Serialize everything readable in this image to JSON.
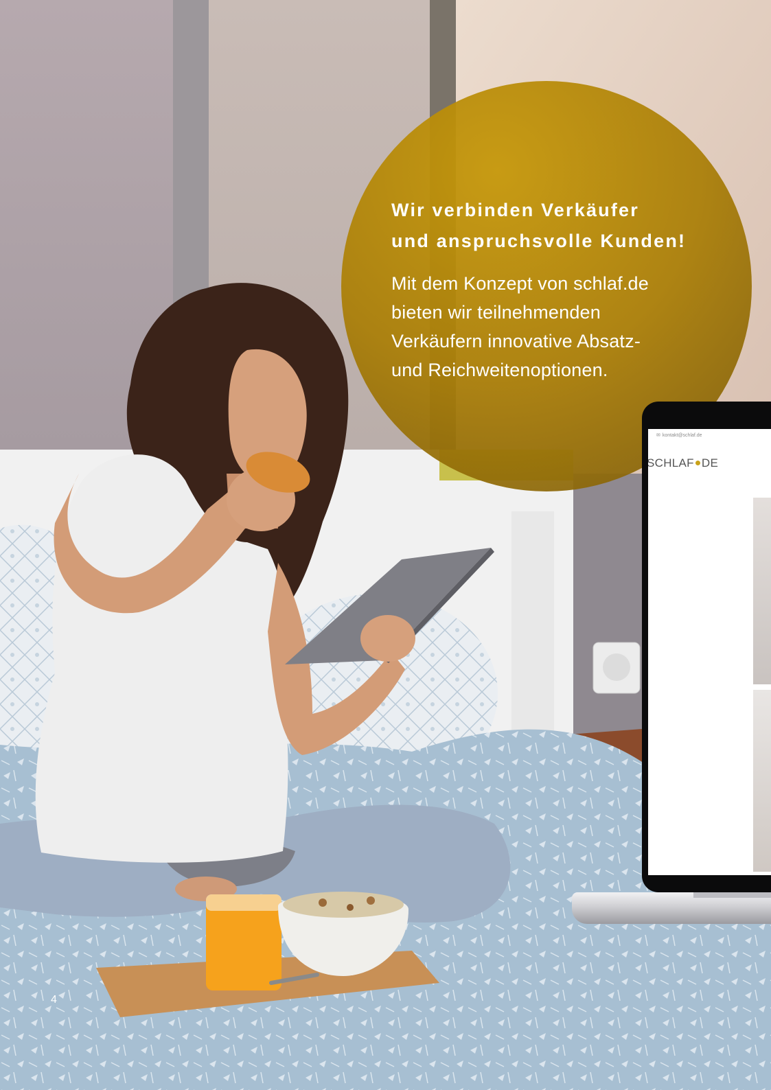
{
  "page": {
    "number": "4"
  },
  "callout": {
    "heading_lines": [
      "Wir verbinden Verkäufer",
      "und anspruchsvolle Kunden!"
    ],
    "body_lines": [
      "Mit dem Konzept von schlaf.de",
      "bieten wir teilnehmenden",
      "Verkäufern innovative Absatz-",
      "und Reichweitenoptionen."
    ],
    "color": "#b88a00",
    "text_color": "#ffffff"
  },
  "laptop_screen": {
    "contact_icon": "mail-icon",
    "contact": "kontakt@schlaf.de",
    "logo_left": "SCHLAF",
    "logo_right": "DE",
    "logo_dot_color": "#c9a21a"
  },
  "colors": {
    "blanket": "#a7bfd2",
    "headboard": "#f1f1f1",
    "juice": "#f6a21c",
    "hair": "#3b2319"
  }
}
